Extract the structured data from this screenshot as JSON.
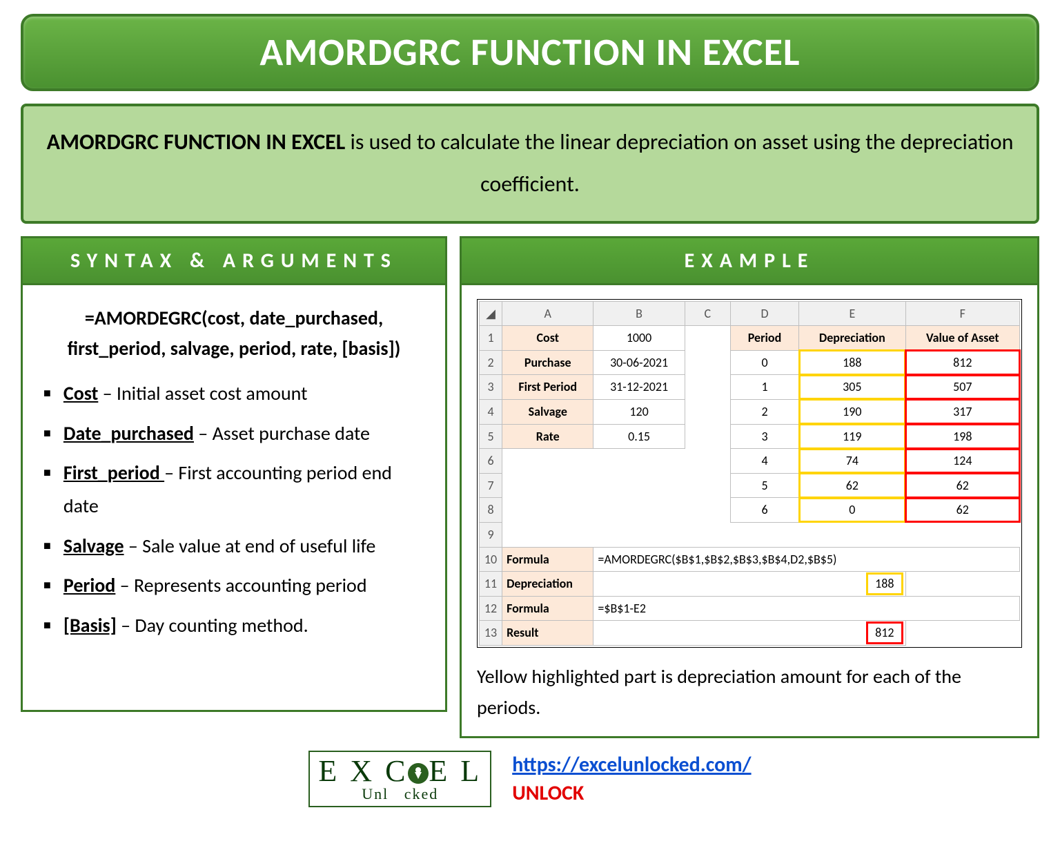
{
  "title": "AMORDGRC FUNCTION IN EXCEL",
  "description": {
    "bold": "AMORDGRC FUNCTION IN EXCEL",
    "rest": " is used to calculate the linear depreciation on asset using the depreciation coefficient."
  },
  "syntax": {
    "header": "SYNTAX & ARGUMENTS",
    "formula": "=AMORDEGRC(cost, date_purchased, first_period, salvage, period, rate, [basis])",
    "args": [
      {
        "term": "Cost",
        "desc": " – Initial asset cost amount"
      },
      {
        "term": "Date_purchased",
        "desc": " – Asset purchase date"
      },
      {
        "term": "First_period ",
        "desc": "– First accounting period end date"
      },
      {
        "term": "Salvage",
        "desc": " – Sale value at end of useful life"
      },
      {
        "term": "Period",
        "desc": " – Represents accounting period"
      },
      {
        "term": "[Basis]",
        "desc": " – Day counting method."
      }
    ]
  },
  "example": {
    "header": "EXAMPLE",
    "cols": [
      "A",
      "B",
      "C",
      "D",
      "E",
      "F"
    ],
    "left_labels": {
      "cost": "Cost",
      "cost_val": "1000",
      "purchase": "Purchase",
      "purchase_val": "30-06-2021",
      "first_period": "First Period",
      "first_period_val": "31-12-2021",
      "salvage": "Salvage",
      "salvage_val": "120",
      "rate": "Rate",
      "rate_val": "0.15"
    },
    "right_headers": {
      "period": "Period",
      "dep": "Depreciation",
      "val": "Value of Asset"
    },
    "rows": [
      {
        "period": "0",
        "dep": "188",
        "val": "812"
      },
      {
        "period": "1",
        "dep": "305",
        "val": "507"
      },
      {
        "period": "2",
        "dep": "190",
        "val": "317"
      },
      {
        "period": "3",
        "dep": "119",
        "val": "198"
      },
      {
        "period": "4",
        "dep": "74",
        "val": "124"
      },
      {
        "period": "5",
        "dep": "62",
        "val": "62"
      },
      {
        "period": "6",
        "dep": "0",
        "val": "62"
      }
    ],
    "formula1_label": "Formula",
    "formula1": "=AMORDEGRC($B$1,$B$2,$B$3,$B$4,D2,$B$5)",
    "dep_label": "Depreciation",
    "dep_result": "188",
    "formula2_label": "Formula",
    "formula2": "=$B$1-E2",
    "result_label": "Result",
    "result_val": "812",
    "note": "Yellow highlighted part is depreciation amount for each of the periods."
  },
  "footer": {
    "logo_top": "EXC EL",
    "logo_bottom": "Unl   cked",
    "url": "https://excelunlocked.com/",
    "unlock": "UNLOCK"
  }
}
